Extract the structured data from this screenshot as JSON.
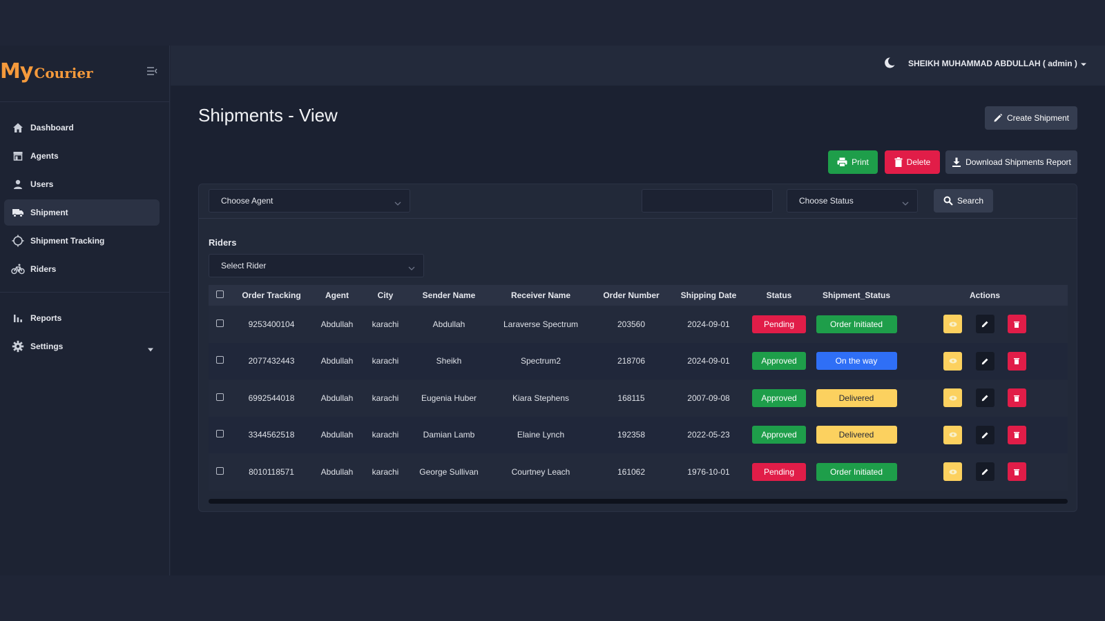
{
  "brand": {
    "part1": "My",
    "part2": "Courier",
    "color": "#f59a3c"
  },
  "sidebar": {
    "items": [
      {
        "label": "Dashboard",
        "icon": "home-icon"
      },
      {
        "label": "Agents",
        "icon": "store-icon"
      },
      {
        "label": "Users",
        "icon": "user-icon"
      },
      {
        "label": "Shipment",
        "icon": "truck-icon",
        "active": true
      },
      {
        "label": "Shipment Tracking",
        "icon": "crosshair-icon"
      },
      {
        "label": "Riders",
        "icon": "bicycle-icon"
      },
      {
        "label": "Reports",
        "icon": "bar-chart-icon"
      },
      {
        "label": "Settings",
        "icon": "gear-icon"
      }
    ]
  },
  "header": {
    "user": "SHEIKH MUHAMMAD ABDULLAH ( admin )"
  },
  "page": {
    "title": "Shipments - View",
    "create_label": "Create Shipment",
    "print_label": "Print",
    "delete_label": "Delete",
    "download_label": "Download Shipments Report"
  },
  "filters": {
    "agent_placeholder": "Choose Agent",
    "search_text": "",
    "status_placeholder": "Choose Status",
    "search_label": "Search",
    "riders_label": "Riders",
    "rider_placeholder": "Select Rider"
  },
  "table": {
    "headers": [
      "Order Tracking",
      "Agent",
      "City",
      "Sender Name",
      "Receiver Name",
      "Order Number",
      "Shipping Date",
      "Status",
      "Shipment_Status",
      "Actions"
    ],
    "rows": [
      {
        "tracking": "9253400104",
        "agent": "Abdullah",
        "city": "karachi",
        "sender": "Abdullah",
        "receiver": "Laraverse Spectrum",
        "order": "203560",
        "date": "2024-09-01",
        "status": "Pending",
        "shipment_status": "Order Initiated"
      },
      {
        "tracking": "2077432443",
        "agent": "Abdullah",
        "city": "karachi",
        "sender": "Sheikh",
        "receiver": "Spectrum2",
        "order": "218706",
        "date": "2024-09-01",
        "status": "Approved",
        "shipment_status": "On the way"
      },
      {
        "tracking": "6992544018",
        "agent": "Abdullah",
        "city": "karachi",
        "sender": "Eugenia Huber",
        "receiver": "Kiara Stephens",
        "order": "168115",
        "date": "2007-09-08",
        "status": "Approved",
        "shipment_status": "Delivered"
      },
      {
        "tracking": "3344562518",
        "agent": "Abdullah",
        "city": "karachi",
        "sender": "Damian Lamb",
        "receiver": "Elaine Lynch",
        "order": "192358",
        "date": "2022-05-23",
        "status": "Approved",
        "shipment_status": "Delivered"
      },
      {
        "tracking": "8010118571",
        "agent": "Abdullah",
        "city": "karachi",
        "sender": "George Sullivan",
        "receiver": "Courtney Leach",
        "order": "161062",
        "date": "1976-10-01",
        "status": "Pending",
        "shipment_status": "Order Initiated"
      }
    ]
  },
  "colors": {
    "pending": "#e11d48",
    "approved": "#1e9e4a",
    "order_initiated": "#1e9e4a",
    "on_the_way": "#2f6ff6",
    "delivered": "#fcd15f"
  }
}
